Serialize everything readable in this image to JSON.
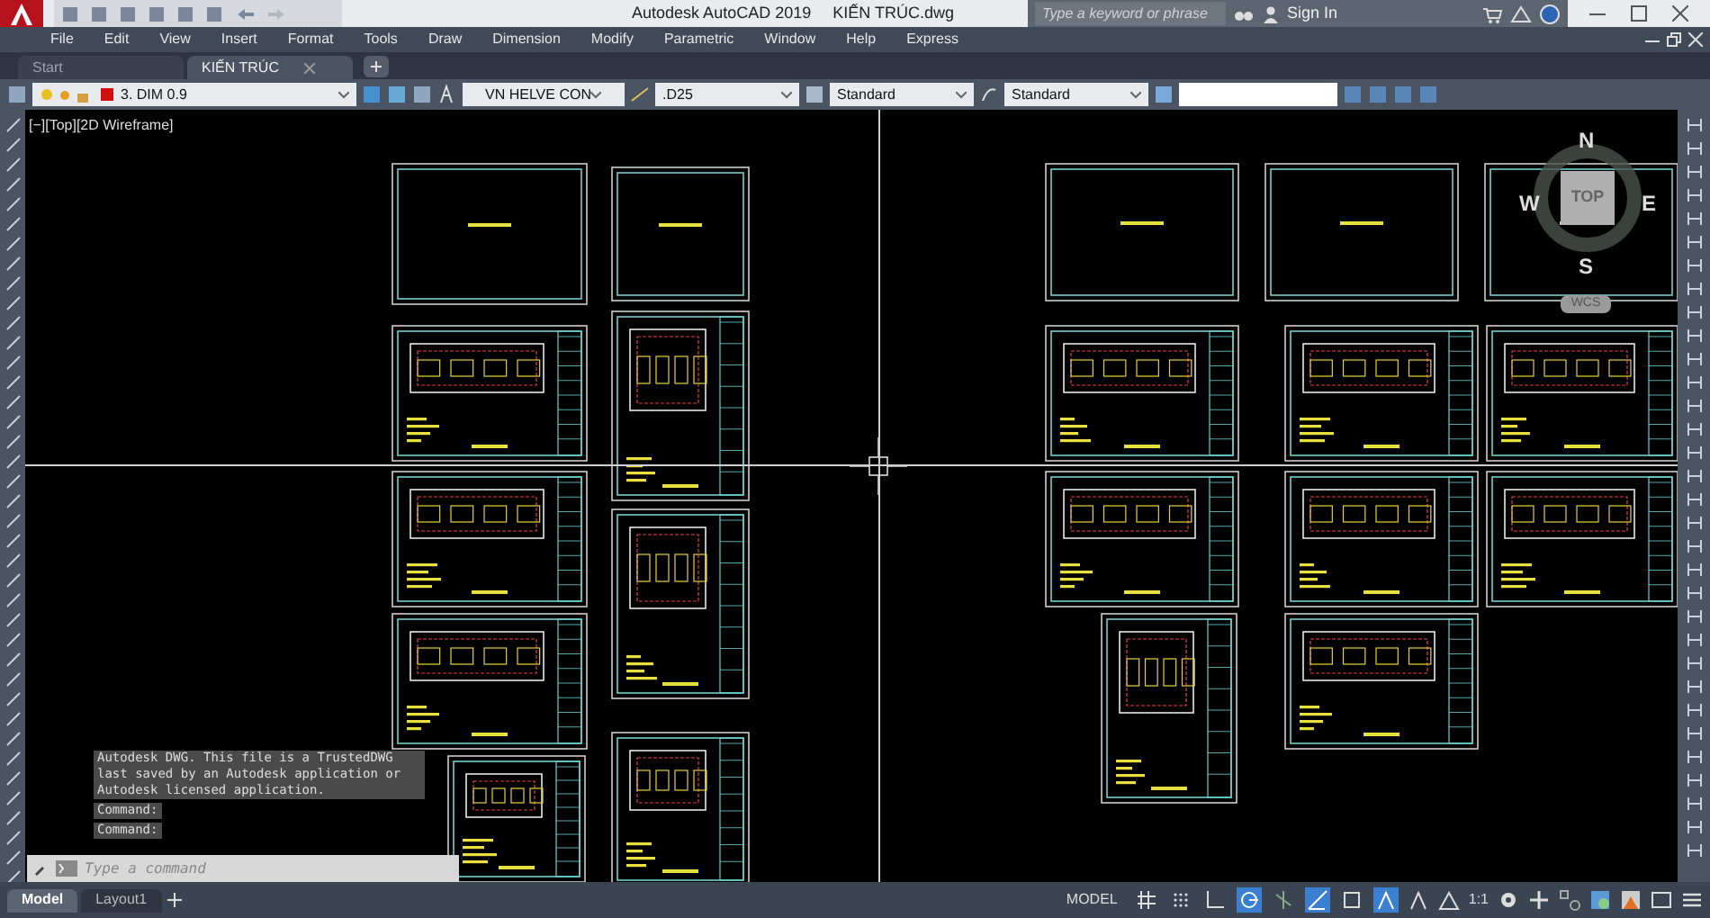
{
  "title_bar": {
    "app": "Autodesk AutoCAD 2019",
    "file": "KIẾN TRÚC.dwg",
    "search": {
      "placeholder": "Type a keyword or phrase"
    },
    "sign_in": "Sign In"
  },
  "menu": [
    "File",
    "Edit",
    "View",
    "Insert",
    "Format",
    "Tools",
    "Draw",
    "Dimension",
    "Modify",
    "Parametric",
    "Window",
    "Help",
    "Express"
  ],
  "tabs": [
    {
      "label": "Start",
      "selected": false
    },
    {
      "label": "KIẾN TRÚC",
      "selected": true
    }
  ],
  "toolbar": {
    "layer": "3. DIM 0.9",
    "text_style": "VN HELVE CON",
    "dim_style": ".D25",
    "table_style": "Standard",
    "multileader_style": "Standard"
  },
  "viewport_label": "[−][Top][2D Wireframe]",
  "viewcube": {
    "north": "N",
    "south": "S",
    "east": "E",
    "west": "W",
    "face": "TOP",
    "ucs": "WCS"
  },
  "command_history": [
    "Autodesk DWG.  This file is a TrustedDWG last saved by an Autodesk application or Autodesk licensed application.",
    "Command:",
    "Command:"
  ],
  "command_line": {
    "placeholder": "Type a command"
  },
  "layout_tabs": [
    {
      "label": "Model",
      "selected": true
    },
    {
      "label": "Layout1",
      "selected": false
    }
  ],
  "status_bar": {
    "space": "MODEL",
    "scale": "1:1",
    "toggles": [
      {
        "kind": "grid",
        "on": false
      },
      {
        "kind": "snap",
        "on": false
      },
      {
        "kind": "ortho",
        "on": false
      },
      {
        "kind": "polar",
        "on": true
      },
      {
        "kind": "isodraft",
        "on": false
      },
      {
        "kind": "osnap-track",
        "on": true
      },
      {
        "kind": "osnap",
        "on": false
      },
      {
        "kind": "annotation",
        "on": true
      }
    ]
  }
}
